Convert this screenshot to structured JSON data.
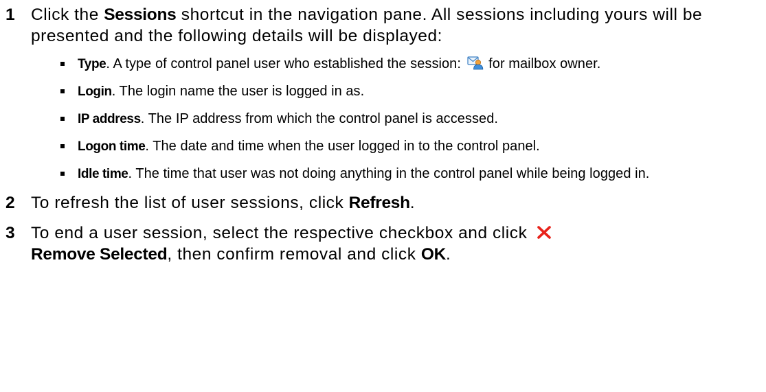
{
  "steps": [
    {
      "number": "1",
      "before": "Click the ",
      "keyword": "Sessions",
      "after": " shortcut in the navigation pane. All sessions including yours will be presented and the following details will be displayed:",
      "bullets": [
        {
          "term": "Type",
          "rest_before_icon": ". A type of control panel user who established the session: ",
          "icon": "mailbox-owner-icon",
          "rest_after_icon": " for mailbox owner."
        },
        {
          "term": "Login",
          "rest": ". The login name the user is logged in as."
        },
        {
          "term": "IP address",
          "rest": ". The IP address from which the control panel is accessed."
        },
        {
          "term": "Logon time",
          "rest": ". The date and time when the user logged in to the control panel."
        },
        {
          "term": "Idle time",
          "rest": ". The time that user was not doing anything in the control panel while being logged in."
        }
      ]
    },
    {
      "number": "2",
      "before": "To refresh the list of user sessions, click ",
      "keyword": "Refresh",
      "after": "."
    },
    {
      "number": "3",
      "before": "To end a user session, select the respective checkbox and click ",
      "icon": "remove-x-icon",
      "keyword": "Remove Selected",
      "middle": ", then confirm removal and click ",
      "keyword2": "OK",
      "after": "."
    }
  ],
  "colors": {
    "text": "#000000",
    "remove_icon": "#e8231b"
  }
}
